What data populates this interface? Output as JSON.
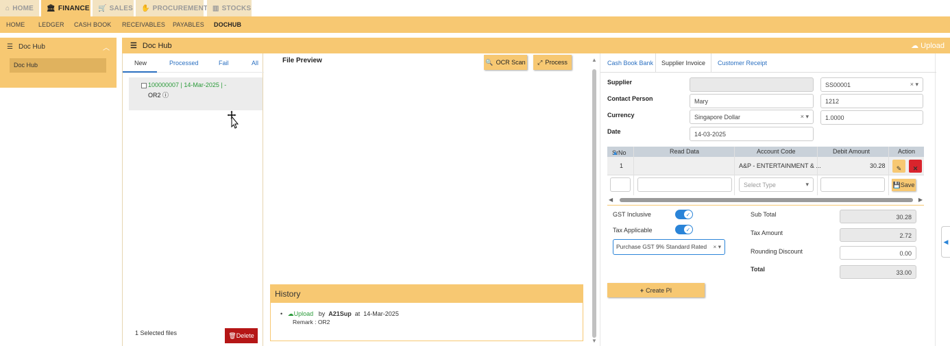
{
  "topnav": {
    "home": "HOME",
    "finance": "FINANCE",
    "sales": "SALES",
    "procurement": "PROCUREMENT",
    "stocks": "STOCKS"
  },
  "subnav": {
    "home": "HOME",
    "ledger": "LEDGER",
    "cashbook": "CASH BOOK",
    "receivables": "RECEIVABLES",
    "payables": "PAYABLES",
    "dochub": "DOCHUB"
  },
  "sidebar": {
    "title": "Doc Hub",
    "item": "Doc Hub"
  },
  "main": {
    "title": "Doc Hub",
    "upload": "Upload"
  },
  "list": {
    "tabs": {
      "new": "New",
      "processed": "Processed",
      "fail": "Fail",
      "all": "All"
    },
    "item": {
      "line1": "100000007 | 14-Mar-2025 | -",
      "line2": "OR2"
    },
    "selected": "1 Selected files",
    "delete": "Delete"
  },
  "preview": {
    "title": "File Preview",
    "ocr": "OCR Scan",
    "process": "Process",
    "history": {
      "title": "History",
      "action": "Upload",
      "by": "by",
      "user": "A21Sup",
      "at": "at",
      "date": "14-Mar-2025",
      "remark": "Remark : OR2"
    }
  },
  "form": {
    "tabs": {
      "cashbook": "Cash Book Bank",
      "supplier": "Supplier Invoice",
      "customer": "Customer Receipt"
    },
    "supplier_label": "Supplier",
    "supplier_code": "SS00001",
    "contact_label": "Contact Person",
    "contact_name": "Mary",
    "contact_no": "1212",
    "currency_label": "Currency",
    "currency": "Singapore Dollar",
    "rate": "1.0000",
    "date_label": "Date",
    "date": "14-03-2025",
    "grid": {
      "headers": {
        "srno": "SrNo",
        "read": "Read Data",
        "account": "Account Code",
        "debit": "Debit Amount",
        "action": "Action"
      },
      "row": {
        "srno": "1",
        "account": "A&P - ENTERTAINMENT & ...",
        "debit": "30.28"
      },
      "select_type": "Select Type",
      "save": "Save"
    },
    "gst_inclusive": "GST Inclusive",
    "tax_applicable": "Tax Applicable",
    "tax_code": "Purchase GST 9% Standard Rated",
    "subtotal_label": "Sub Total",
    "subtotal": "30.28",
    "taxamount_label": "Tax Amount",
    "taxamount": "2.72",
    "rounding_label": "Rounding Discount",
    "rounding": "0.00",
    "total_label": "Total",
    "total": "33.00",
    "create": "Create PI"
  }
}
